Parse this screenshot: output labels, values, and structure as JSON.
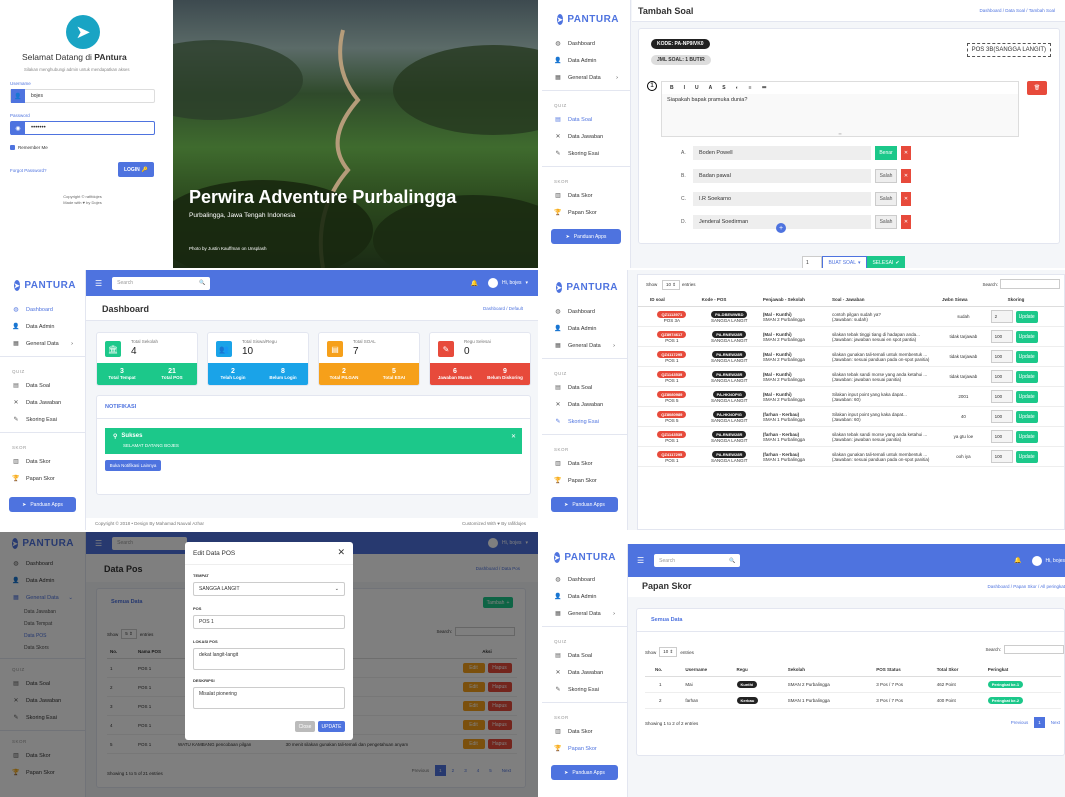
{
  "login": {
    "welcome_prefix": "Selamat Datang di ",
    "welcome_brand": "PAntura",
    "subtitle": "Silakan menghubungi admin untuk mendapatkan akses",
    "username_label": "Username",
    "username_value": "bojes",
    "password_label": "Password",
    "password_value": "•••••••",
    "remember": "Remember Me",
    "forgot": "Forgot Password?",
    "login_btn": "LOGIN",
    "copyright": "Copyright © rafifdojes",
    "made_with": "Made with ♥ by Dojes",
    "hero_title": "Perwira Adventure Purbalingga",
    "hero_subtitle": "Purbalingga, Jawa Tengah Indonesia",
    "photo_credit": "Photo by Justin Kauffman on Unsplash"
  },
  "brand": "PANTURA",
  "sidebar": {
    "items": [
      "Dashboard",
      "Data Admin",
      "General Data"
    ],
    "section_quiz": "QUIZ",
    "quiz_items": [
      "Data Soal",
      "Data Jawaban",
      "Skoring Esai"
    ],
    "section_skor": "SKOR",
    "skor_items": [
      "Data Skor",
      "Papan Skor"
    ],
    "guide": "Panduan Apps",
    "general_subs": [
      "Data Jawaban",
      "Data Tempat",
      "Data POS",
      "Data Skors"
    ]
  },
  "topbar": {
    "search_placeholder": "Search",
    "user": "Hi, bojes"
  },
  "tambah": {
    "title": "Tambah Soal",
    "crumb": "Dashboard / Data Soal / Tambah Soal",
    "kode": "KODE: PA-NP9IVK0",
    "jml": "JML SOAL: 1 BUTIR",
    "pos": "POS 3B(SANGGA LANGIT)",
    "number": "1",
    "question": "Siapakah bapak pramuka dunia?",
    "options": [
      {
        "letter": "A.",
        "text": "Boden Powell",
        "state": "Benar"
      },
      {
        "letter": "B.",
        "text": "Badan pawal",
        "state": "Salah"
      },
      {
        "letter": "C.",
        "text": "I.R Soekarno",
        "state": "Salah"
      },
      {
        "letter": "D.",
        "text": "Jenderal Soedirman",
        "state": "Salah"
      }
    ],
    "count": "1",
    "buat_soal": "BUAT SOAL",
    "selesai": "SELESAI"
  },
  "dashboard": {
    "title": "Dashboard",
    "crumb": "Dashboard / Default",
    "stats": [
      {
        "label": "Total Sekolah",
        "value": "4",
        "color": "#1cc88a",
        "icon": "🏛",
        "f1v": "3",
        "f1l": "Total Tempat",
        "f2v": "21",
        "f2l": "Total POS"
      },
      {
        "label": "Total Siswa/Regu",
        "value": "10",
        "color": "#1aa3e8",
        "icon": "👥",
        "f1v": "2",
        "f1l": "Telah Login",
        "f2v": "8",
        "f2l": "Belum Login"
      },
      {
        "label": "Total SOAL",
        "value": "7",
        "color": "#f6a01a",
        "icon": "▤",
        "f1v": "2",
        "f1l": "Total PILGAN",
        "f2v": "5",
        "f2l": "Total ESAI"
      },
      {
        "label": "Regu Selesai",
        "value": "0",
        "color": "#e74a3b",
        "icon": "✎",
        "f1v": "6",
        "f1l": "Jawaban Masuk",
        "f2v": "9",
        "f2l": "Belum Diskoring"
      }
    ],
    "notif_title": "NOTIFIKASI",
    "alert_title": "Sukses",
    "alert_body": "SELAMAT DATANG BOJES",
    "notif_btn": "Buka Notifikasi Lainnya",
    "footer_left": "Copyright © 2018 • Design By Mahamad Nauval Azhar",
    "footer_right": "Customized With ♥ By rafifdojes"
  },
  "skoring": {
    "show": "Show",
    "entries_val": "10",
    "entries": "entries",
    "search": "Search:",
    "headers": [
      "ID soal",
      "Kode - POS",
      "Penjawab - Sekolah",
      "Soal - Jawaban",
      "Jwbn Siswa",
      "Skoring"
    ],
    "rows": [
      {
        "id": "QZ1113971",
        "pos": "POS 3A",
        "kode": "PA-DBEWWBD",
        "kpos": "SANGGA LANGIT",
        "who": "(Mal - Kunthi)",
        "school": "SMAN 2 Purbalingga",
        "soal": "contoh pilgan sudah ya?",
        "jawab": "(Jawaban: sudah)",
        "siswa": "sudah",
        "skor": "2"
      },
      {
        "id": "QZ8974617",
        "pos": "POS 1",
        "kode": "PA-RNEW28R",
        "kpos": "SANGGA LANGIT",
        "who": "(Mal - Kunthi)",
        "school": "SMAN 2 Purbalingga",
        "soal": "silakan tebak tinggi tiang di hadapan anda...",
        "jawab": "(Jawaban: jawaban sesuai en spot pantia)",
        "siswa": "tidak tarjawab",
        "skor": "100"
      },
      {
        "id": "QZ4117295",
        "pos": "POS 1",
        "kode": "PA-RNEW28R",
        "kpos": "SANGGA LANGIT",
        "who": "(Mal - Kunthi)",
        "school": "SMAN 2 Purbalingga",
        "soal": "silakan gunakan tali-temali untuk membentuk ...",
        "jawab": "(Jawaban: sesuai panduan pada on-spot panitia)",
        "siswa": "tidak tarjawab",
        "skor": "100"
      },
      {
        "id": "QZ1143539",
        "pos": "POS 1",
        "kode": "PA-RNEW28R",
        "kpos": "SANGGA LANGIT",
        "who": "(Mal - Kunthi)",
        "school": "SMAN 2 Purbalingga",
        "soal": "silakan tebak sandi morse yang anda ketahui ...(Jawaban: jawaban sesuai panitia)",
        "jawab": "",
        "siswa": "tidak tarjawab",
        "skor": "100"
      },
      {
        "id": "QZ8080989",
        "pos": "POS 5",
        "kode": "PA-HKNOPIG",
        "kpos": "SANGGA LANGIT",
        "who": "(Mal - Kunthi)",
        "school": "SMAN 2 Purbalingga",
        "soal": "Silakan input point yang kaka dapat...",
        "jawab": "(Jawaban: 60)",
        "siswa": "2001",
        "skor": "100"
      },
      {
        "id": "QZ8080989",
        "pos": "POS 5",
        "kode": "PA-HKNOPIG",
        "kpos": "SANGGA LANGIT",
        "who": "(farhan - Kerbau)",
        "school": "SMAN 1 Purbalingga",
        "soal": "Silakan input point yang kaka dapat...",
        "jawab": "(Jawaban: 60)",
        "siswa": "40",
        "skor": "100"
      },
      {
        "id": "QZ1143539",
        "pos": "POS 1",
        "kode": "PA-RNEW28R",
        "kpos": "SANGGA LANGIT",
        "who": "(farhan - Kerbau)",
        "school": "SMAN 1 Purbalingga",
        "soal": "silakan tebak sandi morse yang anda ketahui ...(Jawaban: jawaban sesuai panitia)",
        "jawab": "",
        "siswa": "ya gtu loe",
        "skor": "100"
      },
      {
        "id": "QZ4117295",
        "pos": "POS 1",
        "kode": "PA-RNEW28R",
        "kpos": "SANGGA LANGIT",
        "who": "(farhan - Kerbau)",
        "school": "SMAN 1 Purbalingga",
        "soal": "silakan gunakan tali-temali untuk membentuk ...",
        "jawab": "(Jawaban: sesuai panduan pada on-spot panitia)",
        "siswa": "ooh iya",
        "skor": "100"
      }
    ],
    "update": "Update"
  },
  "datapos": {
    "title": "Data Pos",
    "crumb": "Dashboard / Data Pos",
    "card_title": "Semua Data",
    "add_btn": "Tambah",
    "show": "Show",
    "entries_val": "5",
    "entries": "entries",
    "search": "Search:",
    "headers": [
      "No.",
      "Nama POS",
      "",
      "",
      "Aksi"
    ],
    "rows": [
      {
        "no": "1",
        "pos": "POS 1"
      },
      {
        "no": "2",
        "pos": "POS 1"
      },
      {
        "no": "3",
        "pos": "POS 1"
      },
      {
        "no": "4",
        "pos": "POS 1"
      },
      {
        "no": "5",
        "pos": "POS 1",
        "place": "WATU KAMBANG",
        "desc": "pencobaan pilgan",
        "dur": "30 menit",
        "extra": "silakan gunakan tali-temali dan pengetahuan anyam"
      }
    ],
    "edit": "Edit",
    "hapus": "Hapus",
    "info": "Showing 1 to 5 of 21 entries",
    "prev": "Previous",
    "pages": [
      "1",
      "2",
      "3",
      "4",
      "5"
    ],
    "next": "Next"
  },
  "modal": {
    "title": "Edit Data POS",
    "tempat_label": "TEMPAT",
    "tempat_value": "SANGGA LANGIT",
    "pos_label": "POS",
    "pos_value": "POS 1",
    "lokasi_label": "LOKASI POS",
    "lokasi_value": "dekat langit-langit",
    "desk_label": "DESKRIPSI",
    "desk_value": "Misalat pionering",
    "close": "Close",
    "update": "UPDATE"
  },
  "papan": {
    "title": "Papan Skor",
    "crumb": "Dashboard / Papan Skor / All peringkat",
    "card_title": "Semua Data",
    "show": "Show",
    "entries_val": "10",
    "entries": "entries",
    "search": "Search:",
    "headers": [
      "No.",
      "Username",
      "Regu",
      "Sekolah",
      "POS Status",
      "Total Skor",
      "Peringkat"
    ],
    "rows": [
      {
        "no": "1",
        "user": "Mai",
        "regu": "Kunthi",
        "school": "SMAN 2 Purbalingga",
        "status": "3 Pos / 7 Pos",
        "skor": "462 Point",
        "rank": "Peringkat ke-1"
      },
      {
        "no": "2",
        "user": "farhan",
        "regu": "Kerbau",
        "school": "SMAN 1 Purbalingga",
        "status": "3 Pos / 7 Pos",
        "skor": "400 Point",
        "rank": "Peringkat ke-2"
      }
    ],
    "info": "Showing 1 to 2 of 2 entries",
    "prev": "Previous",
    "page": "1",
    "next": "Next"
  }
}
